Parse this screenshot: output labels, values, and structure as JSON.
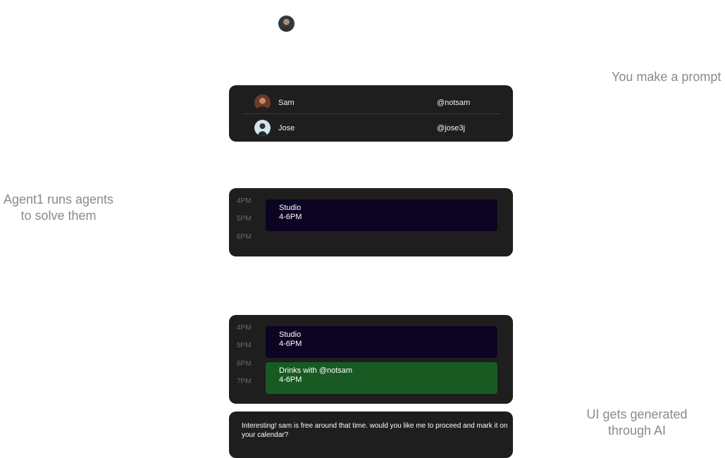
{
  "captions": {
    "prompt": "You make a prompt",
    "agents_line1": "Agent1 runs agents",
    "agents_line2": "to solve them",
    "ui_line1": "UI gets generated",
    "ui_line2": "through AI"
  },
  "contacts": [
    {
      "name": "Sam",
      "handle": "@notsam",
      "avatar": "avatar-sam"
    },
    {
      "name": "Jose",
      "handle": "@jose3j",
      "avatar": "avatar-jose"
    }
  ],
  "calendar_before": {
    "times": [
      "4PM",
      "5PM",
      "6PM"
    ],
    "events": [
      {
        "title": "Studio",
        "time": "4-6PM"
      }
    ]
  },
  "calendar_after": {
    "times": [
      "4PM",
      "5PM",
      "6PM",
      "7PM"
    ],
    "events": [
      {
        "title": "Studio",
        "time": "4-6PM"
      },
      {
        "title": "Drinks with @notsam",
        "time": "4-6PM"
      }
    ]
  },
  "assistant_message": "Interesting! sam is free around that time. would you  like me to proceed and mark it on your calendar?",
  "colors": {
    "card_bg": "#1e1e1e",
    "studio_event": "#0d0322",
    "drinks_event": "#195a22",
    "caption_text": "#8a8a8a"
  }
}
